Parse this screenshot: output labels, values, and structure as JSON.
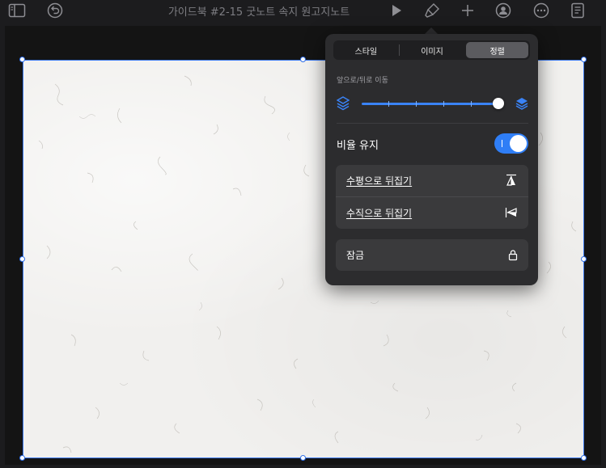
{
  "window": {
    "title": "가이드북 #2-15 굿노트 속지 원고지노트"
  },
  "toolbar": {
    "icons": [
      "sidebar-icon",
      "undo-icon",
      "play-icon",
      "format-brush-icon",
      "plus-icon",
      "collaborate-icon",
      "more-icon",
      "document-icon"
    ]
  },
  "popover": {
    "tabs": [
      {
        "label": "스타일",
        "active": false
      },
      {
        "label": "이미지",
        "active": false
      },
      {
        "label": "정렬",
        "active": true
      }
    ],
    "layer_section": {
      "label": "앞으로/뒤로 이동",
      "slider_value": 1.0
    },
    "keep_ratio": {
      "label": "비율 유지",
      "on": true
    },
    "flip": {
      "horizontal_label": "수평으로 뒤집기",
      "vertical_label": "수직으로 뒤집기"
    },
    "lock": {
      "label": "잠금"
    }
  },
  "colors": {
    "accent": "#2f7ef6",
    "popover_bg": "#2c2c2e",
    "row_bg": "#3a3a3c",
    "page_bg": "#f1f0ee",
    "selection": "#2f6fea"
  }
}
